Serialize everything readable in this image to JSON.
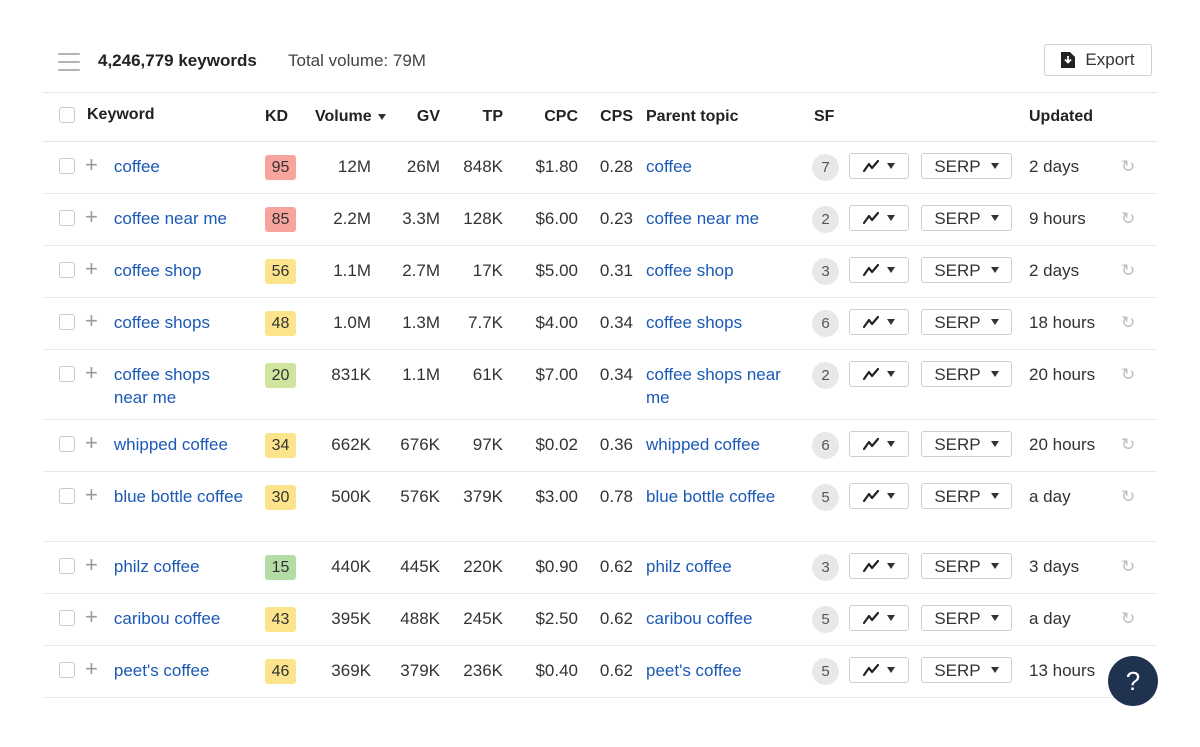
{
  "toolbar": {
    "keyword_count": "4,246,779 keywords",
    "total_volume": "Total volume: 79M",
    "export_label": "Export"
  },
  "columns": {
    "keyword": "Keyword",
    "kd": "KD",
    "volume": "Volume",
    "gv": "GV",
    "tp": "TP",
    "cpc": "CPC",
    "cps": "CPS",
    "parent_topic": "Parent topic",
    "sf": "SF",
    "updated": "Updated"
  },
  "serp_label": "SERP",
  "help_label": "?",
  "kd_colors": {
    "red": "#f7a49c",
    "yellow": "#fbe48b",
    "green": "#b4dca5",
    "lightgreen": "#cfe59e"
  },
  "rows": [
    {
      "keyword": "coffee",
      "kd": "95",
      "kd_color": "red",
      "volume": "12M",
      "gv": "26M",
      "tp": "848K",
      "cpc": "$1.80",
      "cps": "0.28",
      "parent": "coffee",
      "sf": "7",
      "updated": "2 days"
    },
    {
      "keyword": "coffee near me",
      "kd": "85",
      "kd_color": "red",
      "volume": "2.2M",
      "gv": "3.3M",
      "tp": "128K",
      "cpc": "$6.00",
      "cps": "0.23",
      "parent": "coffee near me",
      "sf": "2",
      "updated": "9 hours"
    },
    {
      "keyword": "coffee shop",
      "kd": "56",
      "kd_color": "yellow",
      "volume": "1.1M",
      "gv": "2.7M",
      "tp": "17K",
      "cpc": "$5.00",
      "cps": "0.31",
      "parent": "coffee shop",
      "sf": "3",
      "updated": "2 days"
    },
    {
      "keyword": "coffee shops",
      "kd": "48",
      "kd_color": "yellow",
      "volume": "1.0M",
      "gv": "1.3M",
      "tp": "7.7K",
      "cpc": "$4.00",
      "cps": "0.34",
      "parent": "coffee shops",
      "sf": "6",
      "updated": "18 hours"
    },
    {
      "keyword": "coffee shops near me",
      "kd": "20",
      "kd_color": "lightgreen",
      "volume": "831K",
      "gv": "1.1M",
      "tp": "61K",
      "cpc": "$7.00",
      "cps": "0.34",
      "parent": "coffee shops near me",
      "sf": "2",
      "updated": "20 hours"
    },
    {
      "keyword": "whipped coffee",
      "kd": "34",
      "kd_color": "yellow",
      "volume": "662K",
      "gv": "676K",
      "tp": "97K",
      "cpc": "$0.02",
      "cps": "0.36",
      "parent": "whipped coffee",
      "sf": "6",
      "updated": "20 hours"
    },
    {
      "keyword": "blue bottle coffee",
      "kd": "30",
      "kd_color": "yellow",
      "volume": "500K",
      "gv": "576K",
      "tp": "379K",
      "cpc": "$3.00",
      "cps": "0.78",
      "parent": "blue bottle coffee",
      "sf": "5",
      "updated": "a day"
    },
    {
      "keyword": "philz coffee",
      "kd": "15",
      "kd_color": "green",
      "volume": "440K",
      "gv": "445K",
      "tp": "220K",
      "cpc": "$0.90",
      "cps": "0.62",
      "parent": "philz coffee",
      "sf": "3",
      "updated": "3 days"
    },
    {
      "keyword": "caribou coffee",
      "kd": "43",
      "kd_color": "yellow",
      "volume": "395K",
      "gv": "488K",
      "tp": "245K",
      "cpc": "$2.50",
      "cps": "0.62",
      "parent": "caribou coffee",
      "sf": "5",
      "updated": "a day"
    },
    {
      "keyword": "peet's coffee",
      "kd": "46",
      "kd_color": "yellow",
      "volume": "369K",
      "gv": "379K",
      "tp": "236K",
      "cpc": "$0.40",
      "cps": "0.62",
      "parent": "peet's coffee",
      "sf": "5",
      "updated": "13 hours"
    }
  ]
}
